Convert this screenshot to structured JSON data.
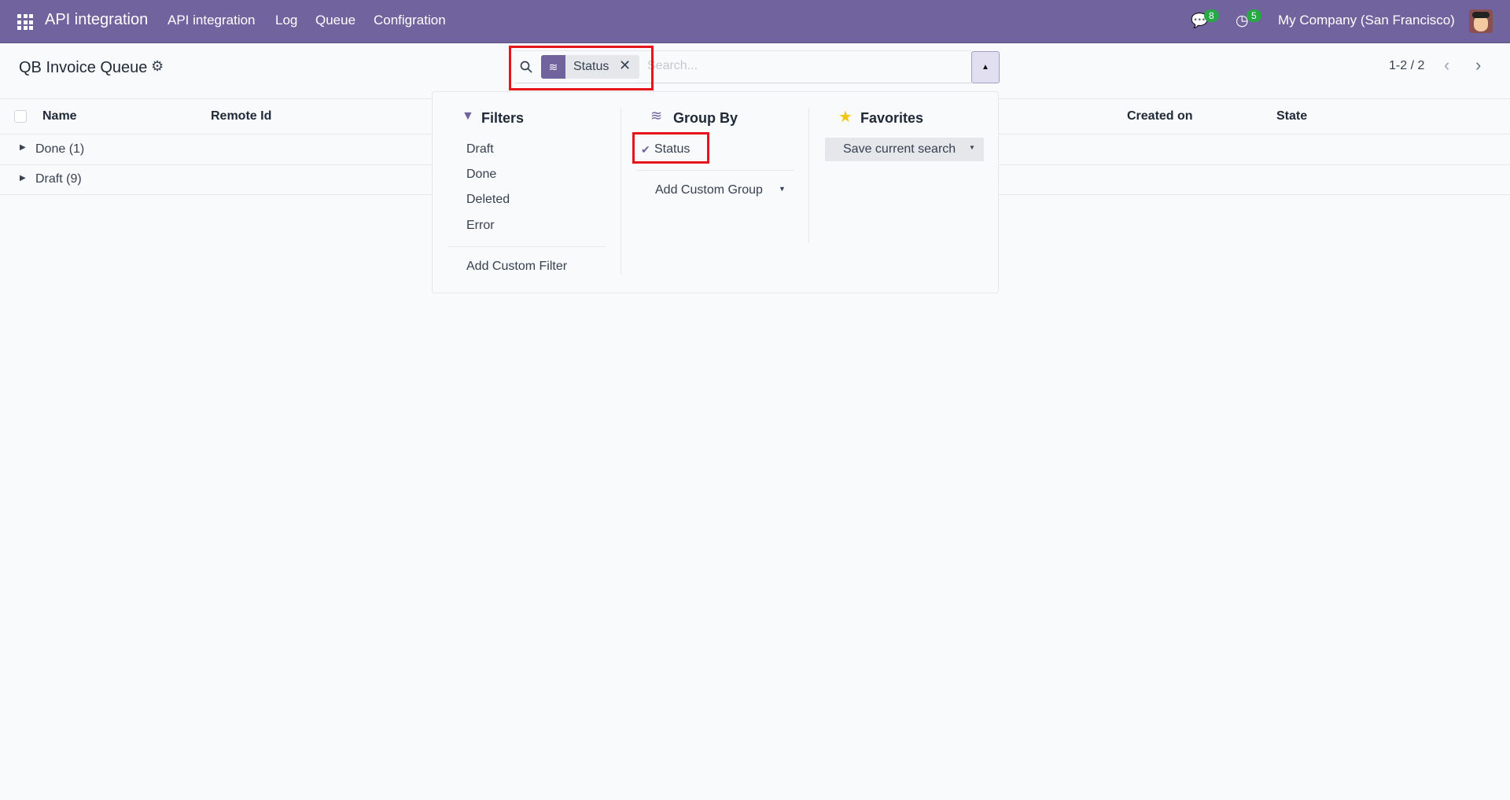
{
  "navbar": {
    "app_title": "API integration",
    "menu": [
      "API integration",
      "Log",
      "Queue",
      "Configration"
    ],
    "messages_count": "8",
    "activities_count": "5",
    "company": "My Company (San Francisco)",
    "brand_color": "#71639e"
  },
  "control": {
    "title": "QB Invoice Queue",
    "facet_label": "Status",
    "search_placeholder": "Search...",
    "pager": "1-2 / 2"
  },
  "table": {
    "columns": [
      "Name",
      "Remote Id",
      "Created on",
      "State"
    ],
    "groups": [
      "Done (1)",
      "Draft (9)"
    ]
  },
  "dropdown": {
    "filters": {
      "title": "Filters",
      "items": [
        "Draft",
        "Done",
        "Deleted",
        "Error"
      ],
      "custom": "Add Custom Filter"
    },
    "groupby": {
      "title": "Group By",
      "items": [
        {
          "label": "Status",
          "checked": true
        }
      ],
      "custom": "Add Custom Group"
    },
    "favorites": {
      "title": "Favorites",
      "save": "Save current search"
    }
  }
}
